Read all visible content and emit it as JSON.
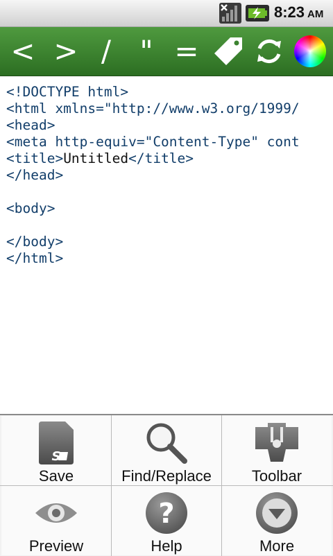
{
  "status_bar": {
    "time": "8:23",
    "ampm": "AM",
    "icons": [
      "signal-icon",
      "battery-charging-icon"
    ]
  },
  "toolbar": {
    "buttons": [
      {
        "label": "<"
      },
      {
        "label": ">"
      },
      {
        "label": "/"
      },
      {
        "label": "\""
      },
      {
        "label": "="
      }
    ],
    "icons": [
      "tag-icon",
      "refresh-icon",
      "color-wheel-icon"
    ]
  },
  "editor": {
    "lines": [
      "<!DOCTYPE html>",
      "<html xmlns=\"http://www.w3.org/1999/",
      "<head>",
      "<meta http-equiv=\"Content-Type\" cont",
      "",
      "</head>",
      "",
      "<body>",
      "",
      "</body>",
      "</html>"
    ],
    "title_line": {
      "open_tag": "<title>",
      "text": "Untitled",
      "close_tag": "</title>"
    }
  },
  "menu": {
    "items": [
      {
        "label": "Save",
        "icon": "sd-card-icon"
      },
      {
        "label": "Find/Replace",
        "icon": "magnifier-icon"
      },
      {
        "label": "Toolbar",
        "icon": "toolbar-icon"
      },
      {
        "label": "Preview",
        "icon": "eye-icon"
      },
      {
        "label": "Help",
        "icon": "help-icon"
      },
      {
        "label": "More",
        "icon": "more-icon"
      }
    ]
  }
}
